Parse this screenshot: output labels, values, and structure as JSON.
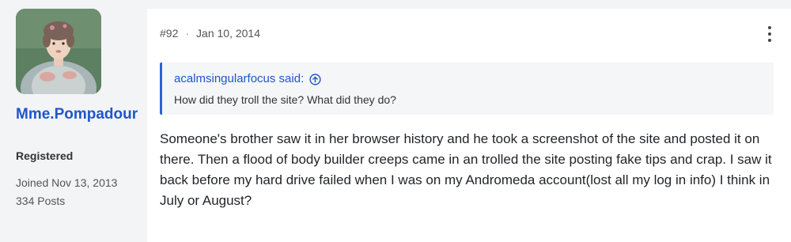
{
  "user": {
    "name": "Mme.Pompadour",
    "role": "Registered",
    "joined": "Joined Nov 13, 2013",
    "posts": "334 Posts"
  },
  "post": {
    "number": "#92",
    "separator": "·",
    "date": "Jan 10, 2014",
    "quote": {
      "author": "acalmsingularfocus said:",
      "text": "How did they troll the site? What did they do?"
    },
    "body": "Someone's brother saw it in her browser history and he took a screenshot of the site and posted it on there. Then a flood of body builder creeps came in an trolled the site posting fake tips and crap. I saw it back before my hard drive failed when I was on my Andromeda account(lost all my log in info) I think in July or August?"
  },
  "icons": {
    "more": "more-vertical-icon",
    "quote_link": "arrow-up-circle-icon"
  },
  "colors": {
    "accent": "#1f56c9",
    "quote_bar": "#2d63d6",
    "page_bg": "#f3f4f6",
    "post_bg": "#ffffff"
  }
}
